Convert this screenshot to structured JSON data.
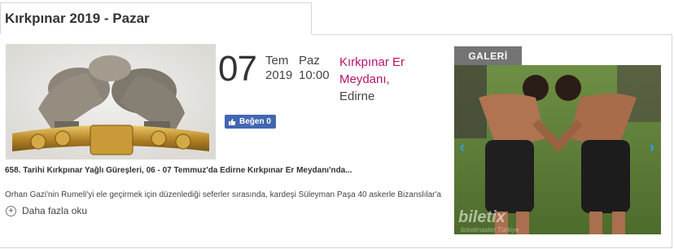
{
  "header": {
    "title": "Kırkpınar 2019 - Pazar"
  },
  "event": {
    "day": "07",
    "month": "Tem",
    "year": "2019",
    "weekday": "Paz",
    "time": "10:00",
    "venue_link": "Kırkpınar Er Meydanı,",
    "city": "Edirne",
    "like_label": "Beğen 0",
    "summary": "658. Tarihi Kırkpınar Yağlı Güreşleri, 06 - 07 Temmuz'da Edirne Kırkpınar Er Meydanı'nda...",
    "description": "Orhan Gazi'nin Rumeli'yi ele geçirmek için düzenlediği seferler sırasında, kardeşi Süleyman Paşa 40 askerle Bizanslılar'a",
    "more_label": "Daha fazla oku"
  },
  "gallery": {
    "tab_label": "GALERİ",
    "watermark": "biletix",
    "watermark_sub": "ticketmaster Türkiye",
    "prev_glyph": "‹",
    "next_glyph": "›"
  },
  "colors": {
    "venue_link": "#b3126e",
    "like_button": "#4267b2",
    "gallery_tab": "#747474",
    "arrow": "#2aa4e0"
  },
  "icons": {
    "facebook": "facebook-thumb-icon",
    "more": "plus-circle-icon"
  }
}
